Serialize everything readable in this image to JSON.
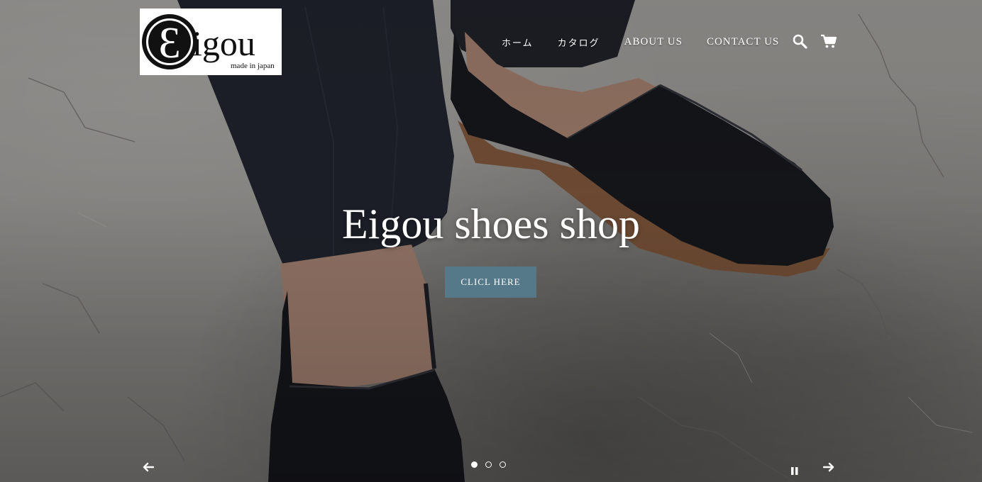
{
  "brand": {
    "logo_text": "igou",
    "logo_letter": "Ɛ",
    "logo_tagline": "made in japan"
  },
  "nav": {
    "items": [
      {
        "label": "ホーム"
      },
      {
        "label": "カタログ"
      },
      {
        "label": "ABOUT US"
      },
      {
        "label": "CONTACT US"
      }
    ],
    "icons": [
      "search-icon",
      "cart-icon"
    ]
  },
  "hero": {
    "title": "Eigou shoes shop",
    "button_label": "CLICL HERE"
  },
  "slideshow": {
    "slide_count": 3,
    "active_slide": 1,
    "controls": [
      "previous-arrow-icon",
      "pause-icon",
      "next-arrow-icon"
    ]
  },
  "colors": {
    "button": "#56798a",
    "text": "#ffffff",
    "logo_bg": "#ffffff"
  }
}
